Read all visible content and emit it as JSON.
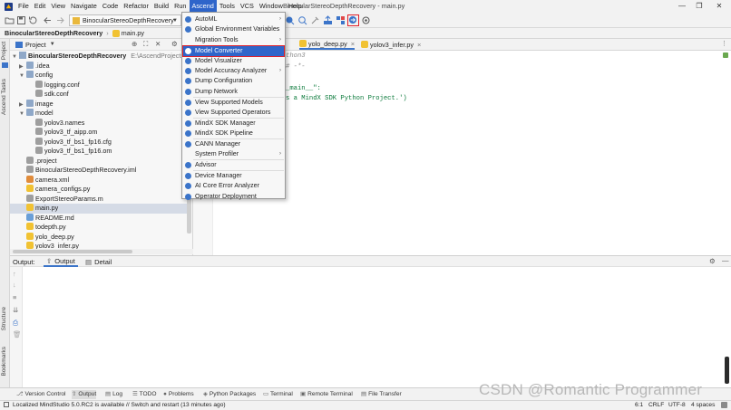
{
  "menubar": {
    "items": [
      "File",
      "Edit",
      "View",
      "Navigate",
      "Code",
      "Refactor",
      "Build",
      "Run",
      "Ascend",
      "Tools",
      "VCS",
      "Window",
      "Help"
    ],
    "active": "Ascend",
    "window_title": "BinocularStereoDepthRecovery - main.py"
  },
  "toolbar": {
    "run_config": "BinocularStereoDepthRecovery"
  },
  "breadcrumb": {
    "project": "BinocularStereoDepthRecovery",
    "file": "main.py"
  },
  "left_strip": {
    "project": "Project",
    "ascend_tasks": "Ascend Tasks",
    "structure": "Structure",
    "bookmarks": "Bookmarks"
  },
  "project_panel": {
    "title": "Project",
    "root": "BinocularStereoDepthRecovery",
    "root_path": "E:\\AscendProjects\\Bi",
    "items": [
      {
        "label": ".idea",
        "type": "folder",
        "depth": 1,
        "expanded": false
      },
      {
        "label": "config",
        "type": "folder",
        "depth": 1,
        "expanded": true
      },
      {
        "label": "logging.conf",
        "type": "file",
        "depth": 2
      },
      {
        "label": "sdk.conf",
        "type": "file",
        "depth": 2
      },
      {
        "label": "image",
        "type": "folder",
        "depth": 1,
        "expanded": false
      },
      {
        "label": "model",
        "type": "folder",
        "depth": 1,
        "expanded": true
      },
      {
        "label": "yolov3.names",
        "type": "file",
        "depth": 2
      },
      {
        "label": "yolov3_tf_aipp.om",
        "type": "file",
        "depth": 2
      },
      {
        "label": "yolov3_tf_bs1_fp16.cfg",
        "type": "file",
        "depth": 2
      },
      {
        "label": "yolov3_tf_bs1_fp16.om",
        "type": "file",
        "depth": 2
      },
      {
        "label": ".project",
        "type": "file",
        "depth": 1
      },
      {
        "label": "BinocularStereoDepthRecovery.iml",
        "type": "file",
        "depth": 1
      },
      {
        "label": "camera.xml",
        "type": "xml",
        "depth": 1
      },
      {
        "label": "camera_configs.py",
        "type": "py",
        "depth": 1
      },
      {
        "label": "ExportStereoParams.m",
        "type": "file",
        "depth": 1
      },
      {
        "label": "main.py",
        "type": "py",
        "depth": 1,
        "selected": true
      },
      {
        "label": "README.md",
        "type": "md",
        "depth": 1
      },
      {
        "label": "todepth.py",
        "type": "py",
        "depth": 1
      },
      {
        "label": "yolo_deep.py",
        "type": "py",
        "depth": 1
      },
      {
        "label": "yolov3_infer.py",
        "type": "py",
        "depth": 1
      }
    ]
  },
  "editor": {
    "tabs": [
      "yolo_deep.py",
      "yolov3_infer.py"
    ],
    "lines": [
      "thon3",
      "# -*-",
      "",
      "",
      "_main__\":",
      "s a MindX SDK Python Project.')"
    ]
  },
  "ascend_menu": {
    "items": [
      {
        "label": "AutoML",
        "submenu": true
      },
      {
        "label": "Global Environment Variables"
      },
      {
        "label": "Migration Tools",
        "submenu": true
      },
      {
        "label": "Model Converter",
        "highlighted": true
      },
      {
        "label": "Model Visualizer"
      },
      {
        "label": "Model Accuracy Analyzer",
        "submenu": true
      },
      {
        "label": "Dump Configuration"
      },
      {
        "label": "Dump Network"
      },
      {
        "label": "View Supported Models"
      },
      {
        "label": "View Supported Operators"
      },
      {
        "label": "MindX SDK Manager"
      },
      {
        "label": "MindX SDK Pipeline"
      },
      {
        "label": "CANN Manager"
      },
      {
        "label": "System Profiler",
        "submenu": true
      },
      {
        "label": "Advisor"
      },
      {
        "label": "Device Manager"
      },
      {
        "label": "AI Core Error Analyzer"
      },
      {
        "label": "Operator Deployment"
      }
    ]
  },
  "bottom_panel": {
    "label": "Output:",
    "tabs": [
      "Output",
      "Detail"
    ],
    "active_tab": "Output"
  },
  "tool_windows": [
    "Version Control",
    "Output",
    "Log",
    "TODO",
    "Problems",
    "Python Packages",
    "Terminal",
    "Remote Terminal",
    "File Transfer"
  ],
  "status": {
    "message": "Localized MindStudio 5.0.RC2 is available // Switch and restart (13 minutes ago)",
    "position": "6:1",
    "line_sep": "CRLF",
    "encoding": "UTF-8",
    "indent": "4 spaces"
  },
  "watermark": "CSDN @Romantic Programmer",
  "colors": {
    "menu_highlight": "#2f65ca",
    "red_outline": "#e0202a"
  }
}
